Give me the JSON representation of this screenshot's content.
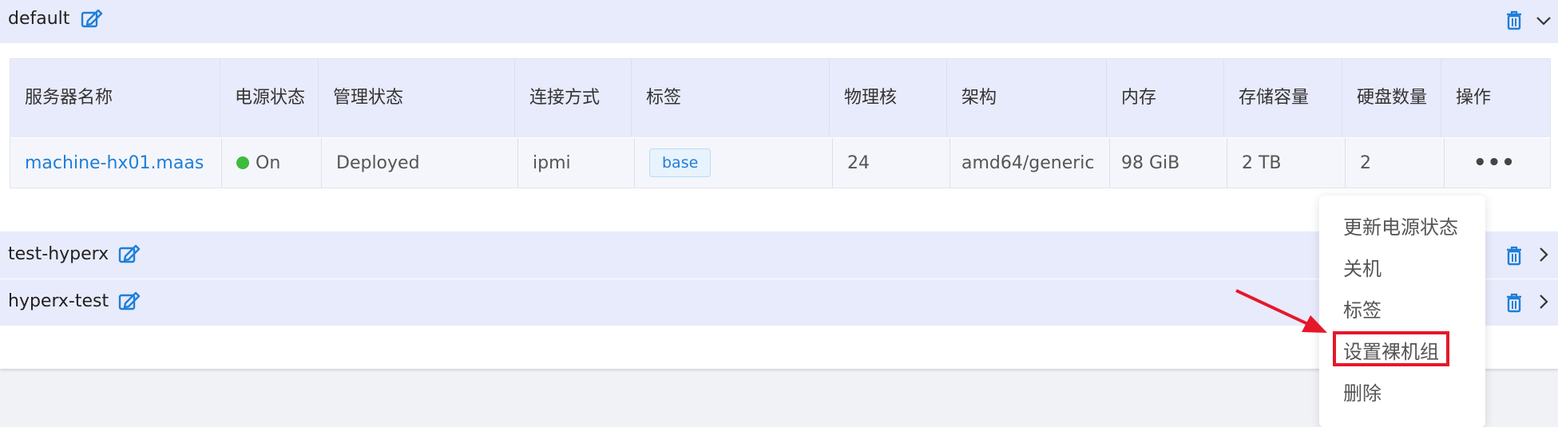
{
  "groups": [
    {
      "name": "default",
      "expanded": true
    },
    {
      "name": "test-hyperx",
      "expanded": false
    },
    {
      "name": "hyperx-test",
      "expanded": false
    }
  ],
  "table": {
    "columns": [
      "服务器名称",
      "电源状态",
      "管理状态",
      "连接方式",
      "标签",
      "物理核",
      "架构",
      "内存",
      "存储容量",
      "硬盘数量",
      "操作"
    ],
    "rows": [
      {
        "name": "machine-hx01.maas",
        "power": "On",
        "status": "Deployed",
        "connection": "ipmi",
        "tag": "base",
        "cores": "24",
        "arch": "amd64/generic",
        "memory": "98 GiB",
        "storage": "2 TB",
        "disks": "2",
        "actions": "•••"
      }
    ]
  },
  "menu": {
    "items": [
      "更新电源状态",
      "关机",
      "标签",
      "设置裸机组",
      "删除"
    ],
    "highlighted": "设置裸机组"
  },
  "colors": {
    "accent": "#1e7fd8",
    "header_bg": "#e8ebfb",
    "power_on": "#3cbc3c",
    "highlight": "#e5182a"
  }
}
